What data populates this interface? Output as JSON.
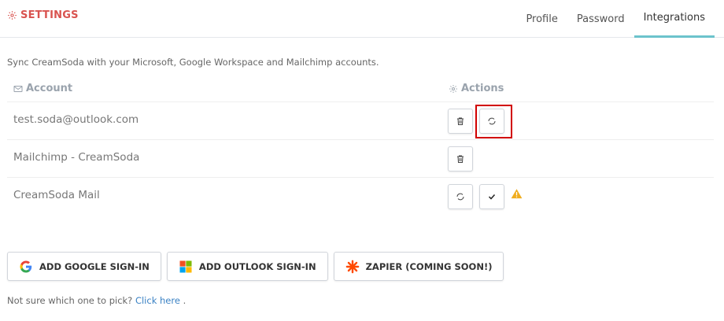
{
  "header": {
    "title": "SETTINGS",
    "tabs": [
      {
        "label": "Profile",
        "active": false
      },
      {
        "label": "Password",
        "active": false
      },
      {
        "label": "Integrations",
        "active": true
      }
    ]
  },
  "description": "Sync CreamSoda with your Microsoft, Google Workspace and Mailchimp accounts.",
  "table": {
    "columns": {
      "account": "Account",
      "actions": "Actions"
    },
    "rows": [
      {
        "account": "test.soda@outlook.com",
        "actions": [
          "delete",
          "sync"
        ]
      },
      {
        "account": "Mailchimp - CreamSoda",
        "actions": [
          "delete"
        ]
      },
      {
        "account": "CreamSoda Mail",
        "actions": [
          "sync",
          "confirm"
        ],
        "warning": true
      }
    ]
  },
  "buttons": {
    "google": "ADD GOOGLE SIGN-IN",
    "outlook": "ADD OUTLOOK SIGN-IN",
    "zapier": "ZAPIER (COMING SOON!)"
  },
  "footer": {
    "text": "Not sure which one to pick?",
    "link": "Click here",
    "suffix": "."
  },
  "colors": {
    "brand": "#d9534f",
    "active_tab_underline": "#6cc3cc",
    "highlight": "#d10000",
    "warning": "#f0ad1f",
    "link": "#3b82c4"
  },
  "icons": [
    "gear-icon",
    "envelope-icon",
    "trash-icon",
    "sync-icon",
    "check-icon",
    "warning-icon",
    "google-icon",
    "microsoft-icon",
    "zapier-icon"
  ]
}
